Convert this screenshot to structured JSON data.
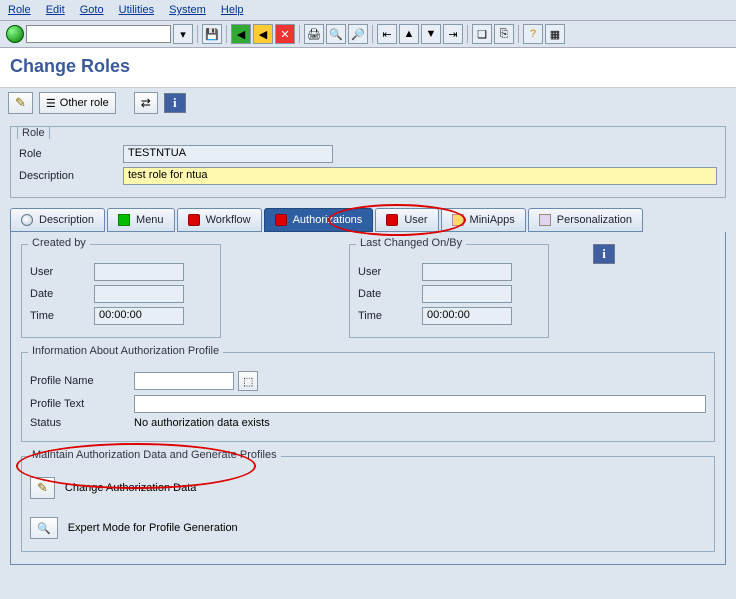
{
  "menubar": {
    "items": [
      "Role",
      "Edit",
      "Goto",
      "Utilities",
      "System",
      "Help"
    ]
  },
  "page": {
    "title": "Change Roles"
  },
  "app_toolbar": {
    "other_role": "Other role"
  },
  "role_group": {
    "title": "Role",
    "role_label": "Role",
    "role_value": "TESTNTUA",
    "desc_label": "Description",
    "desc_value": "test role for ntua"
  },
  "tabs": {
    "items": [
      {
        "label": "Description",
        "icon": "mag"
      },
      {
        "label": "Menu",
        "icon": "green"
      },
      {
        "label": "Workflow",
        "icon": "red"
      },
      {
        "label": "Authorizations",
        "icon": "red",
        "active": true
      },
      {
        "label": "User",
        "icon": "red"
      },
      {
        "label": "MiniApps",
        "icon": "mini"
      },
      {
        "label": "Personalization",
        "icon": "pers"
      }
    ]
  },
  "created": {
    "title": "Created by",
    "user_label": "User",
    "user_value": "",
    "date_label": "Date",
    "date_value": "",
    "time_label": "Time",
    "time_value": "00:00:00"
  },
  "changed": {
    "title": "Last Changed On/By",
    "user_label": "User",
    "user_value": "",
    "date_label": "Date",
    "date_value": "",
    "time_label": "Time",
    "time_value": "00:00:00"
  },
  "profile_info": {
    "title": "Information About Authorization Profile",
    "name_label": "Profile Name",
    "name_value": "",
    "text_label": "Profile Text",
    "text_value": "",
    "status_label": "Status",
    "status_value": "No authorization data exists"
  },
  "maintain": {
    "title": "Maintain Authorization Data and Generate Profiles",
    "change_label": "Change Authorization Data",
    "expert_label": "Expert Mode for Profile Generation"
  }
}
